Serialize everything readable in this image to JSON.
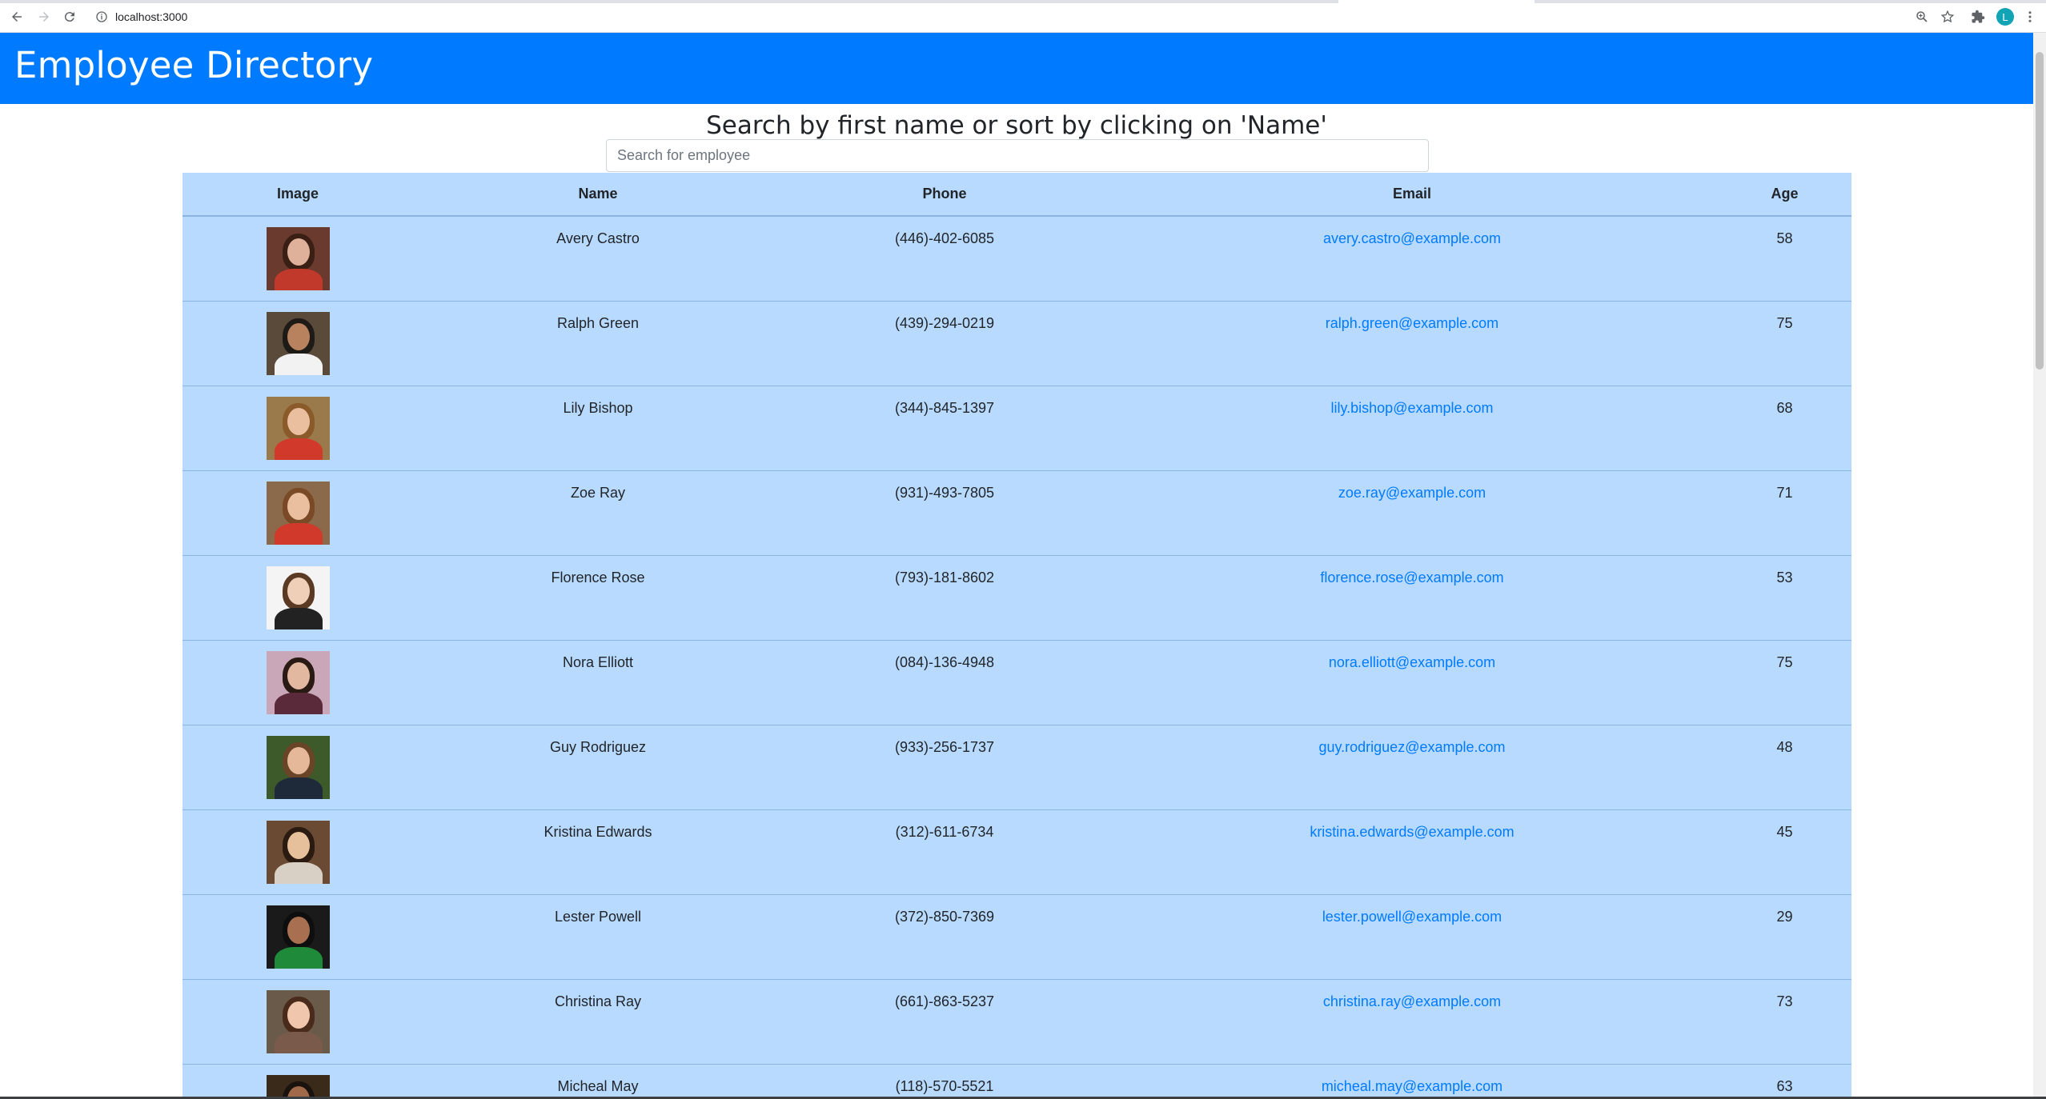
{
  "browser": {
    "url": "localhost:3000",
    "profile_initial": "L"
  },
  "header": {
    "title": "Employee Directory"
  },
  "search": {
    "heading": "Search by first name or sort by clicking on 'Name'",
    "placeholder": "Search for employee",
    "value": ""
  },
  "table": {
    "columns": [
      "Image",
      "Name",
      "Phone",
      "Email",
      "Age"
    ],
    "rows": [
      {
        "name": "Avery Castro",
        "phone": "(446)-402-6085",
        "email": "avery.castro@example.com",
        "age": "58"
      },
      {
        "name": "Ralph Green",
        "phone": "(439)-294-0219",
        "email": "ralph.green@example.com",
        "age": "75"
      },
      {
        "name": "Lily Bishop",
        "phone": "(344)-845-1397",
        "email": "lily.bishop@example.com",
        "age": "68"
      },
      {
        "name": "Zoe Ray",
        "phone": "(931)-493-7805",
        "email": "zoe.ray@example.com",
        "age": "71"
      },
      {
        "name": "Florence Rose",
        "phone": "(793)-181-8602",
        "email": "florence.rose@example.com",
        "age": "53"
      },
      {
        "name": "Nora Elliott",
        "phone": "(084)-136-4948",
        "email": "nora.elliott@example.com",
        "age": "75"
      },
      {
        "name": "Guy Rodriguez",
        "phone": "(933)-256-1737",
        "email": "guy.rodriguez@example.com",
        "age": "48"
      },
      {
        "name": "Kristina Edwards",
        "phone": "(312)-611-6734",
        "email": "kristina.edwards@example.com",
        "age": "45"
      },
      {
        "name": "Lester Powell",
        "phone": "(372)-850-7369",
        "email": "lester.powell@example.com",
        "age": "29"
      },
      {
        "name": "Christina Ray",
        "phone": "(661)-863-5237",
        "email": "christina.ray@example.com",
        "age": "73"
      },
      {
        "name": "Micheal May",
        "phone": "(118)-570-5521",
        "email": "micheal.may@example.com",
        "age": "63"
      }
    ]
  },
  "colors": {
    "header_bg": "#007bff",
    "table_bg": "#b8daff",
    "link": "#007bff"
  }
}
